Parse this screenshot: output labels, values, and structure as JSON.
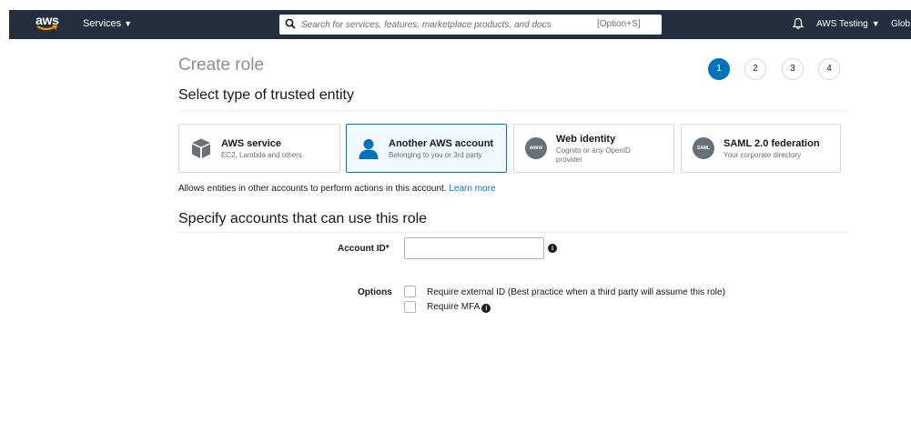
{
  "topbar": {
    "logo_text": "aws",
    "services_label": "Services",
    "search_placeholder": "Search for services, features, marketplace products, and docs",
    "search_shortcut": "[Option+S]",
    "account_label": "AWS Testing",
    "region_label": "Glob"
  },
  "page": {
    "title": "Create role",
    "steps": [
      "1",
      "2",
      "3",
      "4"
    ],
    "active_step": 1
  },
  "trusted_entity": {
    "heading": "Select type of trusted entity",
    "tiles": [
      {
        "title": "AWS service",
        "subtitle": "EC2, Lambda and others",
        "icon": "cube-icon",
        "selected": false
      },
      {
        "title": "Another AWS account",
        "subtitle": "Belonging to you or 3rd party",
        "icon": "user-icon",
        "selected": true
      },
      {
        "title": "Web identity",
        "subtitle": "Cognito or any OpenID provider",
        "icon": "www-icon",
        "icon_text": "www",
        "selected": false
      },
      {
        "title": "SAML 2.0 federation",
        "subtitle": "Your corporate directory",
        "icon": "saml-icon",
        "icon_text": "SAML",
        "selected": false
      }
    ],
    "description": "Allows entities in other accounts to perform actions in this account.",
    "learn_more": "Learn more"
  },
  "accounts": {
    "heading": "Specify accounts that can use this role",
    "account_id_label": "Account ID*",
    "account_id_value": "",
    "options_label": "Options",
    "options": [
      {
        "label": "Require external ID (Best practice when a third party will assume this role)",
        "checked": false
      },
      {
        "label": "Require MFA",
        "checked": false
      }
    ]
  },
  "colors": {
    "nav_bg": "#232f3e",
    "accent": "#0073bb",
    "selected_tile_bg": "#f1faff",
    "icon_gray": "#687078"
  }
}
